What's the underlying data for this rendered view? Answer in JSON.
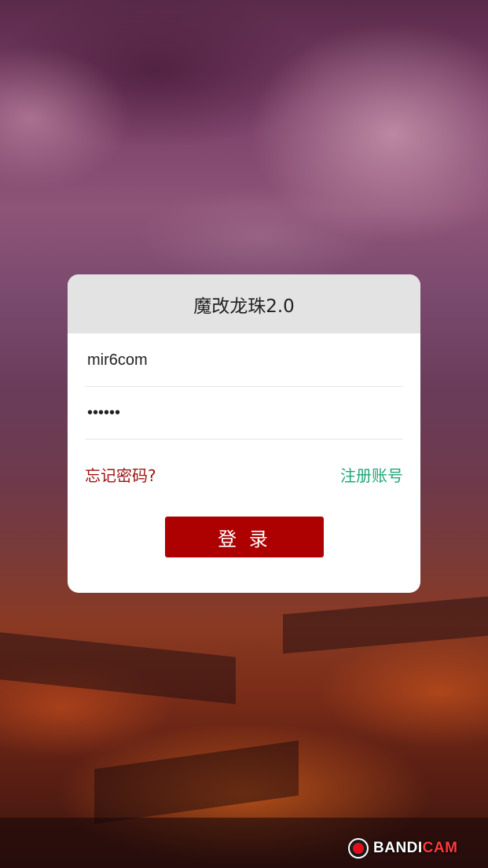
{
  "login": {
    "title": "魔改龙珠2.0",
    "username_value": "mir6com",
    "password_value": "••••••",
    "forgot_label": "忘记密码?",
    "register_label": "注册账号",
    "submit_label": "登 录"
  },
  "watermark": {
    "brand_part1": "BANDI",
    "brand_part2": "CAM"
  },
  "colors": {
    "header_bg": "#e3e3e3",
    "button_bg": "#ad0000",
    "forgot_text": "#9e1111",
    "register_text": "#22a675"
  },
  "icons": {
    "watermark_logo": "record-icon"
  }
}
